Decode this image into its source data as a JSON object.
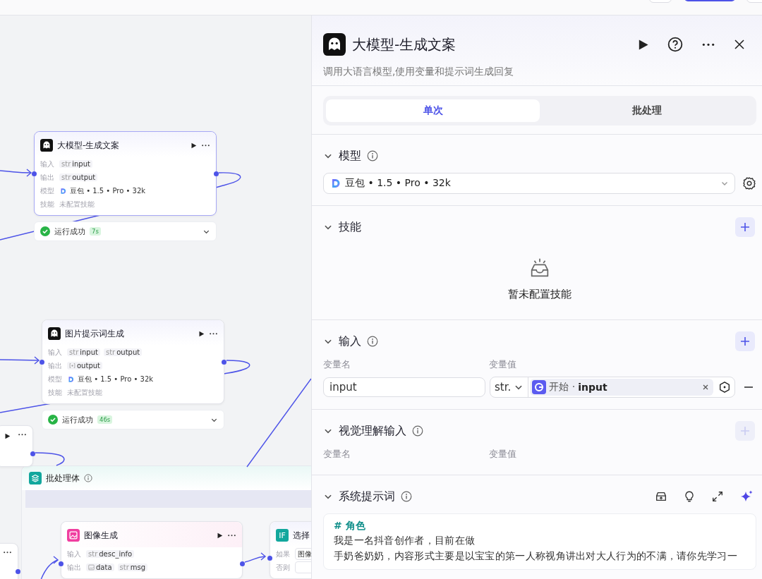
{
  "toolbar": {
    "buttons": [
      {
        "kind": "secondary"
      },
      {
        "kind": "primary"
      },
      {
        "kind": "secondary"
      }
    ]
  },
  "canvas": {
    "nodes": [
      {
        "kind": "llm",
        "title": "大模型-生成文案",
        "selected": true,
        "rows": [
          {
            "label": "输入",
            "values": [
              {
                "kind": "typed",
                "prefix": "str",
                "text": "input"
              }
            ]
          },
          {
            "label": "输出",
            "values": [
              {
                "kind": "typed",
                "prefix": "str",
                "text": "output"
              }
            ]
          },
          {
            "label": "模型",
            "values": [
              {
                "kind": "model",
                "text": "豆包 • 1.5 • Pro • 32k"
              }
            ]
          },
          {
            "label": "技能",
            "values": [
              {
                "kind": "note",
                "text": "未配置技能"
              }
            ]
          }
        ],
        "status": {
          "text": "运行成功",
          "time": "7s"
        }
      },
      {
        "kind": "llm",
        "title": "图片提示词生成",
        "selected": false,
        "rows": [
          {
            "label": "输入",
            "values": [
              {
                "kind": "typed",
                "prefix": "str",
                "text": "input"
              },
              {
                "kind": "typed",
                "prefix": "str",
                "text": "output"
              }
            ]
          },
          {
            "label": "输出",
            "values": [
              {
                "kind": "array",
                "text": "output"
              }
            ]
          },
          {
            "label": "模型",
            "values": [
              {
                "kind": "model",
                "text": "豆包 • 1.5 • Pro • 32k"
              }
            ]
          },
          {
            "label": "技能",
            "values": [
              {
                "kind": "note",
                "text": "未配置技能"
              }
            ]
          }
        ],
        "status": {
          "text": "运行成功",
          "time": "46s"
        }
      },
      {
        "kind": "stub"
      },
      {
        "kind": "stub_edge"
      }
    ],
    "batch": {
      "title": "批处理体",
      "nodes": [
        {
          "kind": "image",
          "title": "图像生成",
          "selected": false,
          "rows": [
            {
              "label": "输入",
              "values": [
                {
                  "kind": "typed",
                  "prefix": "str",
                  "text": "desc_info"
                }
              ]
            },
            {
              "label": "输出",
              "values": [
                {
                  "kind": "image",
                  "text": "data"
                },
                {
                  "kind": "typed",
                  "prefix": "str",
                  "text": "msg"
                }
              ]
            }
          ]
        },
        {
          "kind": "condition",
          "icon_text": "IF",
          "title": "选择",
          "selected": false,
          "rows": [
            {
              "label": "如果",
              "values": [
                {
                  "kind": "field",
                  "text": "图像"
                }
              ]
            },
            {
              "label": "否则",
              "values": [
                {
                  "kind": "field"
                }
              ]
            }
          ]
        }
      ]
    }
  },
  "panel": {
    "title": "大模型-生成文案",
    "description": "调用大语言模型,使用变量和提示词生成回复",
    "tabs": [
      {
        "label": "单次",
        "selected": true
      },
      {
        "label": "批处理",
        "selected": false
      }
    ],
    "sections": [
      {
        "kind": "model",
        "title": "模型",
        "expanded": true,
        "info": true,
        "model": "豆包 • 1.5 • Pro • 32k"
      },
      {
        "kind": "skills",
        "title": "技能",
        "expanded": true,
        "info": false,
        "add_disabled": false,
        "empty_text": "暂未配置技能"
      },
      {
        "kind": "inputs",
        "title": "输入",
        "expanded": true,
        "info": true,
        "add_disabled": false,
        "columns": [
          "变量名",
          "变量值"
        ],
        "rows": [
          {
            "name": "input",
            "type": "str.",
            "source": "开始 ·",
            "variable": "input"
          }
        ]
      },
      {
        "kind": "inputs",
        "title": "视觉理解输入",
        "expanded": true,
        "info": true,
        "add_disabled": true,
        "columns": [
          "变量名",
          "变量值"
        ]
      },
      {
        "kind": "prompt",
        "title": "系统提示词",
        "expanded": true,
        "info": true,
        "heading": "# 角色",
        "lines": [
          "我是一名抖音创作者，目前在做",
          "手奶爸奶奶，内容形式主要是以宝宝的第一人称视角讲出对大人行为的不满，请你先学习一"
        ]
      }
    ]
  }
}
